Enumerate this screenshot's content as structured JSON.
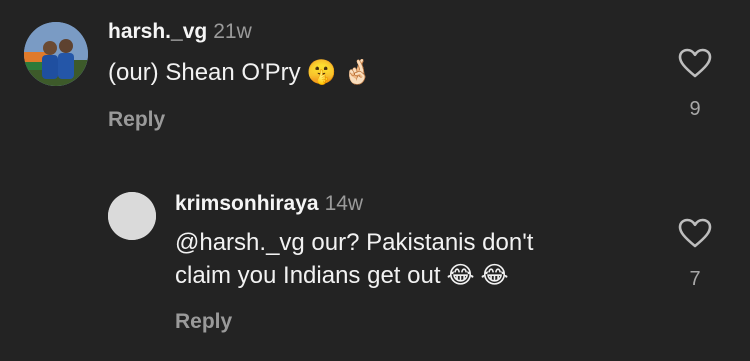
{
  "comments": [
    {
      "username": "harsh._vg",
      "time": "21w",
      "text": "(our) Shean O'Pry",
      "emojis": [
        "🤫",
        "🤞🏻"
      ],
      "reply_label": "Reply",
      "like_count": "9"
    },
    {
      "username": "krimsonhiraya",
      "time": "14w",
      "line1": "@harsh._vg our? Pakistanis don't",
      "line2": "claim you Indians get out",
      "emojis": [
        "😂",
        "😂"
      ],
      "reply_label": "Reply",
      "like_count": "7"
    }
  ],
  "colors": {
    "background": "#232323",
    "text": "#f2f2f2",
    "muted": "#9a9a9a"
  }
}
